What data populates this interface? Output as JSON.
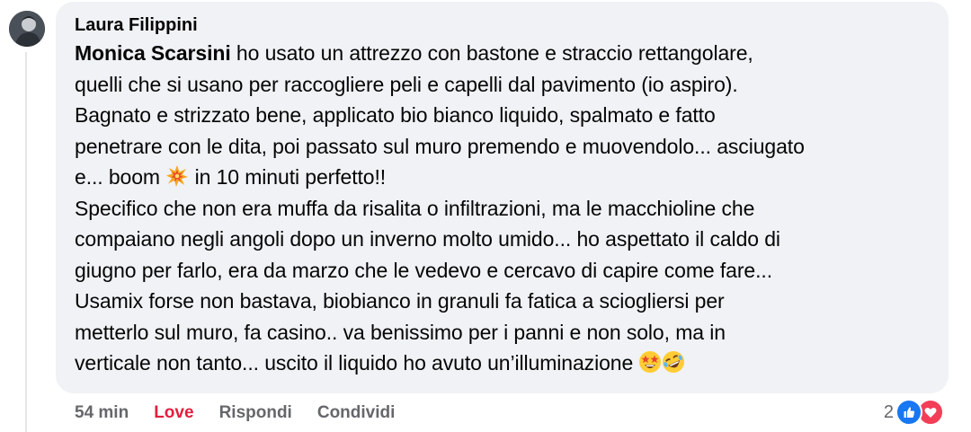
{
  "comment": {
    "author": "Laura Filippini",
    "mention": "Monica Scarsini",
    "lines": [
      " ho usato un attrezzo con bastone e straccio rettangolare,",
      "quelli che si usano per raccogliere peli e capelli dal pavimento (io aspiro).",
      "Bagnato e strizzato bene, applicato bio bianco liquido, spalmato e fatto",
      "penetrare con le dita, poi passato sul muro premendo e muovendolo... asciugato",
      "e... boom ",
      " in 10 minuti perfetto!!",
      "Specifico che non era muffa da risalita o infiltrazioni, ma le macchioline che",
      "compaiano negli angoli dopo un inverno molto umido... ho aspettato il caldo di",
      "giugno per farlo, era da marzo che le vedevo e cercavo di capire come fare...",
      "Usamix forse non bastava, biobianco in granuli fa fatica a sciogliersi per",
      "metterlo sul muro, fa casino.. va benissimo per i panni e non solo, ma in",
      "verticale non tanto... uscito il liquido ho avuto un’illuminazione "
    ],
    "emojis": {
      "boom": "collision-emoji",
      "end_1": "star-struck-emoji",
      "end_2": "rolling-laughing-emoji"
    }
  },
  "actions": {
    "time": "54 min",
    "love": "Love",
    "reply": "Rispondi",
    "share": "Condividi"
  },
  "reactions": {
    "count": "2",
    "types": [
      "like-icon",
      "love-icon"
    ],
    "colors": {
      "like": "#1877f2",
      "love": "#f33e58",
      "love_label": "#e41e3f"
    }
  }
}
